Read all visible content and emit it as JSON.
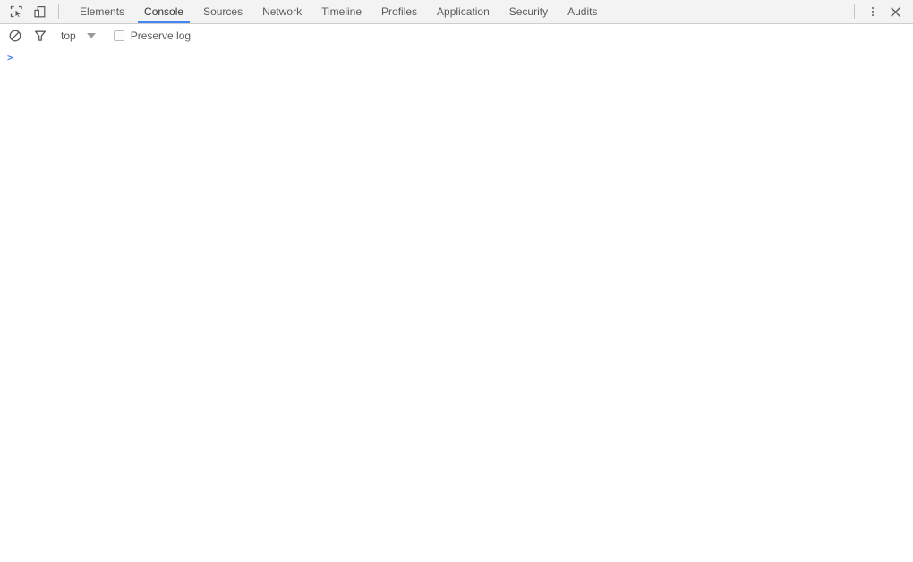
{
  "window": {
    "title": "DevTools",
    "background": "#ffffff"
  },
  "theme": {
    "accent": "#4285f4",
    "tabbar_background": "#f3f3f3",
    "border": "#cdcdcd",
    "text": "#5a5a5a",
    "active_text": "#333333",
    "prompt": "#4285f4"
  },
  "tabbar": {
    "inspect_icon": "inspect-element-icon",
    "device_icon": "device-toolbar-icon",
    "tabs": [
      {
        "label": "Elements",
        "active": false
      },
      {
        "label": "Console",
        "active": true
      },
      {
        "label": "Sources",
        "active": false
      },
      {
        "label": "Network",
        "active": false
      },
      {
        "label": "Timeline",
        "active": false
      },
      {
        "label": "Profiles",
        "active": false
      },
      {
        "label": "Application",
        "active": false
      },
      {
        "label": "Security",
        "active": false
      },
      {
        "label": "Audits",
        "active": false
      }
    ],
    "more_icon": "kebab-menu-icon",
    "close_icon": "close-icon"
  },
  "filterbar": {
    "clear_icon": "clear-console-icon",
    "filter_icon": "filter-funnel-icon",
    "context": {
      "value": "top",
      "caret_icon": "chevron-down-icon"
    },
    "preserve_log": {
      "label": "Preserve log",
      "checked": false
    }
  },
  "console": {
    "messages": [],
    "prompt": {
      "chevron": ">",
      "value": "",
      "placeholder": ""
    }
  }
}
